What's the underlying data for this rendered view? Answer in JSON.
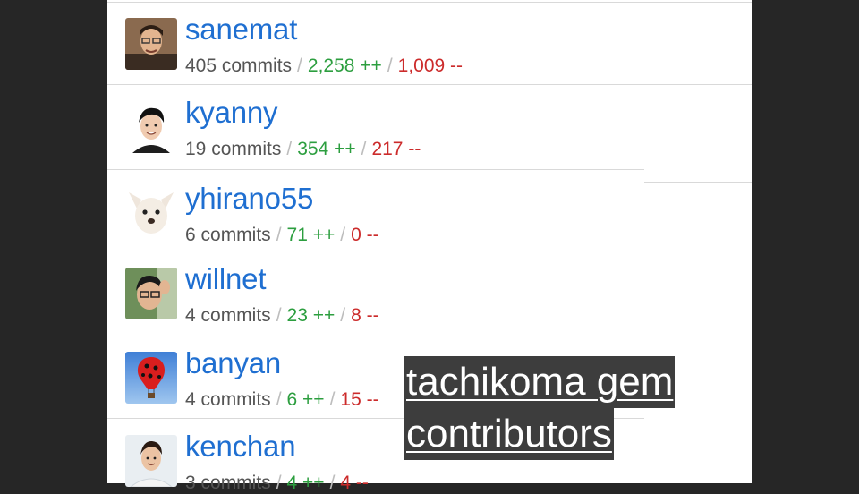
{
  "contributors": [
    {
      "name": "sanemat",
      "commits": "405 commits",
      "additions": "2,258 ++",
      "deletions": "1,009 --"
    },
    {
      "name": "kyanny",
      "commits": "19 commits",
      "additions": "354 ++",
      "deletions": "217 --"
    },
    {
      "name": "yhirano55",
      "commits": "6 commits",
      "additions": "71 ++",
      "deletions": "0 --"
    },
    {
      "name": "willnet",
      "commits": "4 commits",
      "additions": "23 ++",
      "deletions": "8 --"
    },
    {
      "name": "banyan",
      "commits": "4 commits",
      "additions": "6 ++",
      "deletions": "15 --"
    },
    {
      "name": "kenchan",
      "commits": "3 commits",
      "additions": "4 ++",
      "deletions": "4 --"
    }
  ],
  "separator": "/",
  "caption": {
    "line1": "tachikoma gem",
    "line2": "contributors"
  },
  "colors": {
    "name": "#1f6fd1",
    "additions": "#2c9e3f",
    "deletions": "#cc2b2b",
    "meta": "#555555"
  }
}
